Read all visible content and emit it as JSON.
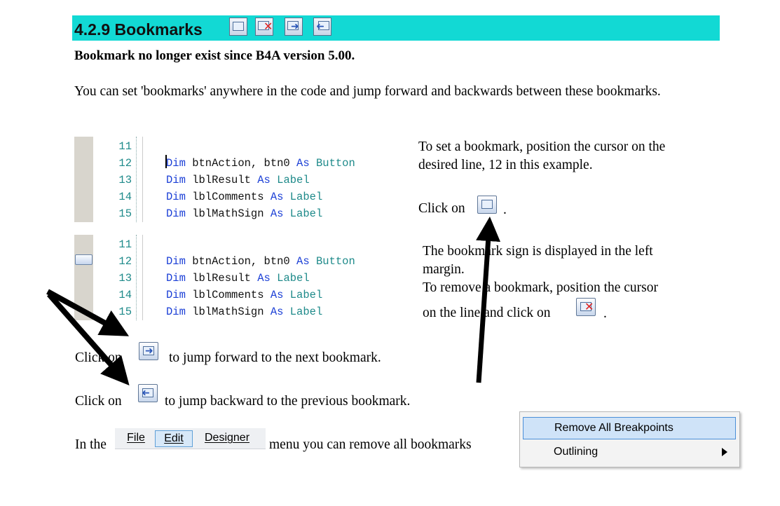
{
  "section": {
    "title": "4.2.9 Bookmarks",
    "header_icons": [
      "toggle-bookmark-icon",
      "remove-bookmark-icon",
      "next-bookmark-icon",
      "previous-bookmark-icon"
    ],
    "accent_color": "#12d9d4"
  },
  "notice": "Bookmark no longer exist since B4A version 5.00.",
  "intro": "You can set 'bookmarks' anywhere in the code and jump forward and backwards between these bookmarks.",
  "code_block_1": {
    "lines": [
      {
        "num": "11",
        "parts": []
      },
      {
        "num": "12",
        "parts": [
          [
            "kw",
            "Dim"
          ],
          [
            "tx",
            " btnAction, btn0 "
          ],
          [
            "kw",
            "As"
          ],
          [
            "tx",
            " "
          ],
          [
            "ty",
            "Button"
          ]
        ]
      },
      {
        "num": "13",
        "parts": [
          [
            "kw",
            "Dim"
          ],
          [
            "tx",
            " lblResult "
          ],
          [
            "kw",
            "As"
          ],
          [
            "tx",
            " "
          ],
          [
            "ty",
            "Label"
          ]
        ]
      },
      {
        "num": "14",
        "parts": [
          [
            "kw",
            "Dim"
          ],
          [
            "tx",
            " lblComments "
          ],
          [
            "kw",
            "As"
          ],
          [
            "tx",
            " "
          ],
          [
            "ty",
            "Label"
          ]
        ]
      },
      {
        "num": "15",
        "parts": [
          [
            "kw",
            "Dim"
          ],
          [
            "tx",
            " lblMathSign "
          ],
          [
            "kw",
            "As"
          ],
          [
            "tx",
            " "
          ],
          [
            "ty",
            "Label"
          ]
        ]
      }
    ]
  },
  "code_block_2": {
    "lines": [
      {
        "num": "11",
        "parts": []
      },
      {
        "num": "12",
        "parts": [
          [
            "kw",
            "Dim"
          ],
          [
            "tx",
            " btnAction, btn0 "
          ],
          [
            "kw",
            "As"
          ],
          [
            "tx",
            " "
          ],
          [
            "ty",
            "Button"
          ]
        ]
      },
      {
        "num": "13",
        "parts": [
          [
            "kw",
            "Dim"
          ],
          [
            "tx",
            " lblResult "
          ],
          [
            "kw",
            "As"
          ],
          [
            "tx",
            " "
          ],
          [
            "ty",
            "Label"
          ]
        ]
      },
      {
        "num": "14",
        "parts": [
          [
            "kw",
            "Dim"
          ],
          [
            "tx",
            " lblComments "
          ],
          [
            "kw",
            "As"
          ],
          [
            "tx",
            " "
          ],
          [
            "ty",
            "Label"
          ]
        ]
      },
      {
        "num": "15",
        "parts": [
          [
            "kw",
            "Dim"
          ],
          [
            "tx",
            " lblMathSign "
          ],
          [
            "kw",
            "As"
          ],
          [
            "tx",
            " "
          ],
          [
            "ty",
            "Label"
          ]
        ]
      }
    ]
  },
  "right_text_1": {
    "line1": "To set a bookmark, position the cursor on the",
    "line2": "desired line, 12 in this example.",
    "click_on": "Click on",
    "period": "."
  },
  "right_text_2": {
    "line1": "The bookmark sign is displayed in the left",
    "line2": "margin.",
    "line3": "To remove a bookmark, position the cursor",
    "line4": "on the line and click on",
    "period": "."
  },
  "jump_forward": {
    "click_on": "Click on",
    "rest": "to jump forward to the next bookmark."
  },
  "jump_backward": {
    "click_on": "Click on",
    "rest": "to jump backward to the previous bookmark."
  },
  "menu_line": {
    "prefix": "In the",
    "suffix": "menu you can remove all bookmarks",
    "menus": [
      {
        "label": "File",
        "selected": false
      },
      {
        "label": "Edit",
        "selected": true
      },
      {
        "label": "Designer",
        "selected": false
      }
    ]
  },
  "context_menu": {
    "items": [
      {
        "label": "Remove All Breakpoints",
        "highlighted": true,
        "submenu": false
      },
      {
        "label": "Outlining",
        "highlighted": false,
        "submenu": true
      }
    ]
  }
}
